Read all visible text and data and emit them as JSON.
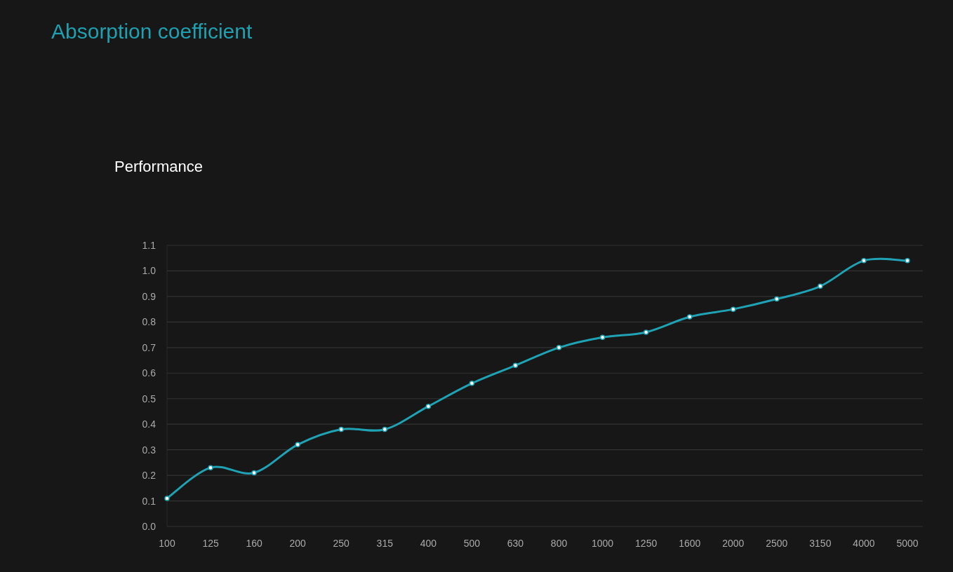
{
  "heading": "Absorption coefficient",
  "chart_title": "Performance",
  "chart_data": {
    "type": "line",
    "categories": [
      "100",
      "125",
      "160",
      "200",
      "250",
      "315",
      "400",
      "500",
      "630",
      "800",
      "1000",
      "1250",
      "1600",
      "2000",
      "2500",
      "3150",
      "4000",
      "5000"
    ],
    "grid": true,
    "series": [
      {
        "color": "#1fa3b4",
        "marker": true,
        "values": [
          0.11,
          0.23,
          0.21,
          0.32,
          0.38,
          0.38,
          0.47,
          0.56,
          0.63,
          0.7,
          0.74,
          0.76,
          0.82,
          0.85,
          0.89,
          0.94,
          1.04,
          1.04
        ]
      }
    ],
    "ylim": [
      0,
      1.1
    ],
    "yticks": [
      {
        "value": 0,
        "label": "0.0"
      },
      {
        "value": 0.1,
        "label": "0.1"
      },
      {
        "value": 0.2,
        "label": "0.2"
      },
      {
        "value": 0.3,
        "label": "0.3"
      },
      {
        "value": 0.4,
        "label": "0.4"
      },
      {
        "value": 0.5,
        "label": "0.5"
      },
      {
        "value": 0.6,
        "label": "0.6"
      },
      {
        "value": 0.7,
        "label": "0.7"
      },
      {
        "value": 0.8,
        "label": "0.8"
      },
      {
        "value": 0.9,
        "label": "0.9"
      },
      {
        "value": 1,
        "label": "1.0"
      },
      {
        "value": 1.1,
        "label": "1.1"
      }
    ]
  }
}
